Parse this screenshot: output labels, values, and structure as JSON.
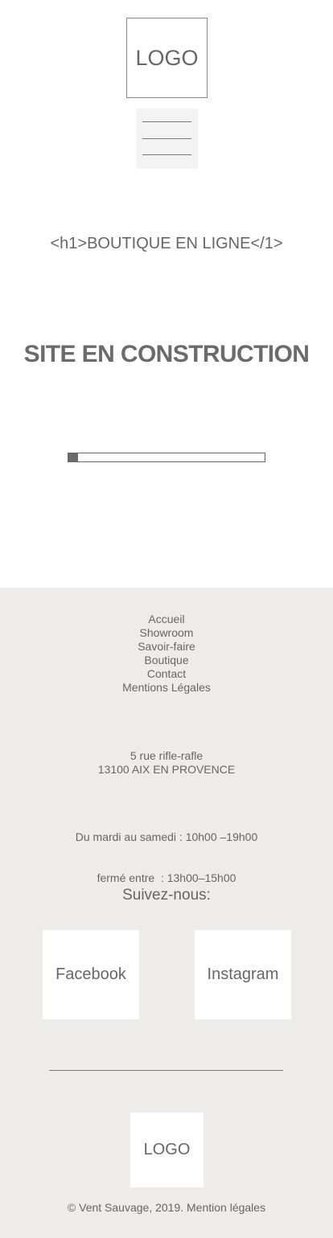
{
  "header": {
    "logo_text": "LOGO",
    "menu_icon": "hamburger-menu-icon"
  },
  "main": {
    "h1_text": "<h1>BOUTIQUE EN LIGNE</1>",
    "construction_text": "SITE EN CONSTRUCTION",
    "progress_percent": 5
  },
  "footer": {
    "nav": [
      {
        "label": "Accueil"
      },
      {
        "label": "Showroom"
      },
      {
        "label": "Savoir-faire"
      },
      {
        "label": "Boutique"
      },
      {
        "label": "Contact"
      },
      {
        "label": "Mentions Légales"
      }
    ],
    "address_line1": "5 rue rifle-rafle",
    "address_line2": "13100 AIX EN PROVENCE",
    "hours_line1": "Du mardi au samedi : 10h00 –19h00",
    "hours_line2": "fermé entre  : 13h00–15h00",
    "follow_label": "Suivez-nous:",
    "facebook_label": "Facebook",
    "instagram_label": "Instagram",
    "logo_text": "LOGO",
    "copyright": "© Vent Sauvage, 2019. Mention légales"
  },
  "colors": {
    "text": "#666666",
    "footer_bg": "#edecea",
    "burger_bg": "#f3f3f3"
  }
}
